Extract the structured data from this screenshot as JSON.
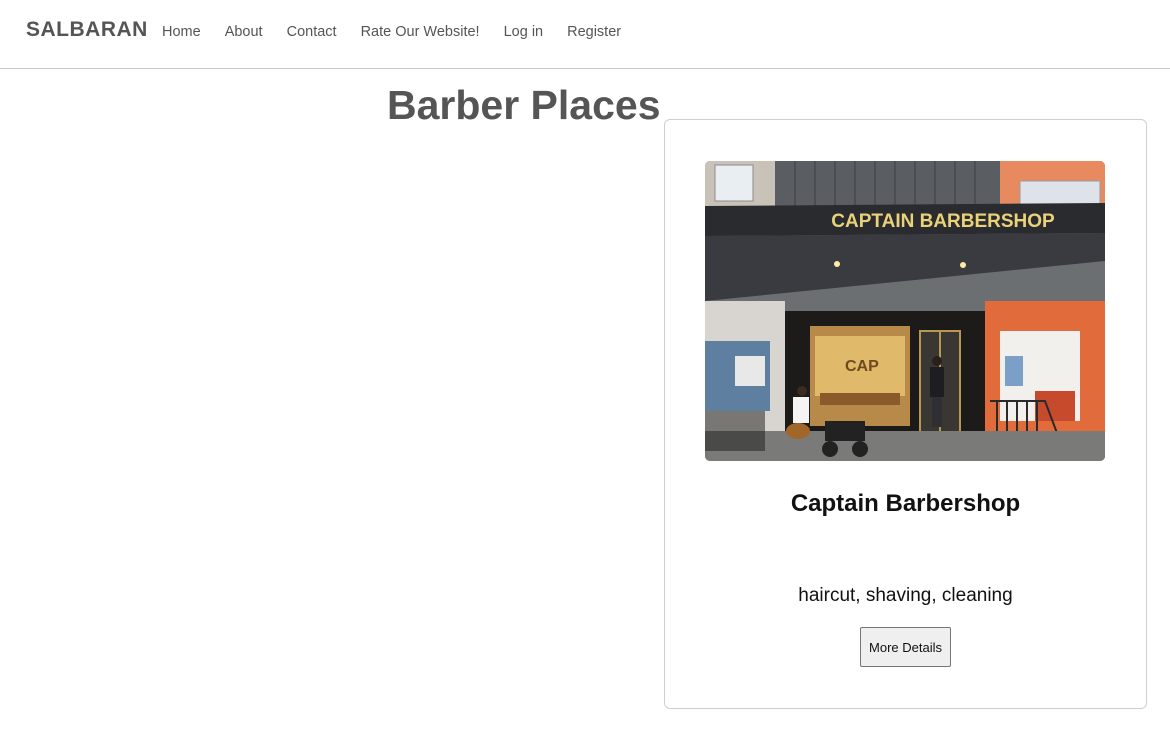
{
  "nav": {
    "brand": "SALBARAN",
    "links": [
      "Home",
      "About",
      "Contact",
      "Rate Our Website!",
      "Log in",
      "Register"
    ]
  },
  "main": {
    "title": "Barber Places"
  },
  "card": {
    "image_sign_text": "CAPTAIN BARBERSHOP",
    "title": "Captain Barbershop",
    "services": "haircut, shaving, cleaning",
    "button_label": "More Details"
  }
}
